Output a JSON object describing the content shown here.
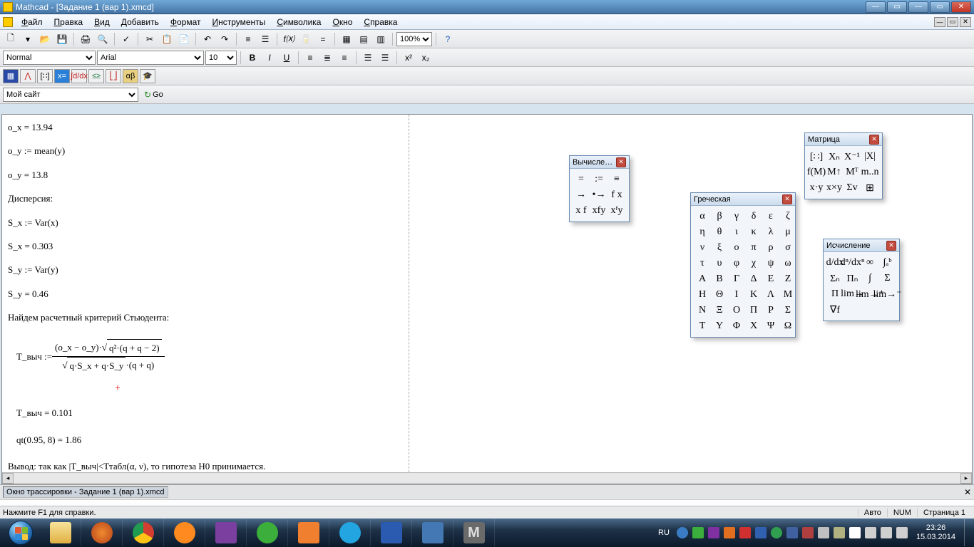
{
  "title": "Mathcad - [Задание 1 (вар 1).xmcd]",
  "menu": [
    "Файл",
    "Правка",
    "Вид",
    "Добавить",
    "Формат",
    "Инструменты",
    "Символика",
    "Окно",
    "Справка"
  ],
  "format_toolbar": {
    "style": "Normal",
    "font": "Arial",
    "size": "10"
  },
  "zoom": "100%",
  "addrbar": {
    "site": "Мой сайт",
    "go": "Go"
  },
  "doc": {
    "l1": "o_x = 13.94",
    "l2": "o_y := mean(y)",
    "l3": "o_y = 13.8",
    "l4": "Дисперсия:",
    "l5": "S_x := Var(x)",
    "l6": "S_x = 0.303",
    "l7": "S_y := Var(y)",
    "l8": "S_y = 0.46",
    "l9": "Найдем расчетный критерий Стьюдента:",
    "f_lhs": "T_выч := ",
    "f_num_a": "(o_x − o_y)·",
    "f_num_b": "q²·(q + q − 2)",
    "f_den_a": "q·S_x + q·S_y",
    "f_den_b": "·(q + q)",
    "l10": "T_выч = 0.101",
    "l11": "qt(0.95, 8) = 1.86",
    "l12": "Вывод: так как |T_выч|<Tтабл(α, ν), то гипотеза H0 принимается."
  },
  "palettes": {
    "vychisl": {
      "title": "Вычисле…",
      "cells": [
        "=",
        ":=",
        "≡",
        "→",
        "•→",
        "f x",
        "x f",
        "xfy",
        "xᶠy"
      ]
    },
    "greek": {
      "title": "Греческая",
      "cells": [
        "α",
        "β",
        "γ",
        "δ",
        "ε",
        "ζ",
        "η",
        "θ",
        "ι",
        "κ",
        "λ",
        "μ",
        "ν",
        "ξ",
        "ο",
        "π",
        "ρ",
        "σ",
        "τ",
        "υ",
        "φ",
        "χ",
        "ψ",
        "ω",
        "Α",
        "Β",
        "Γ",
        "Δ",
        "Ε",
        "Ζ",
        "Η",
        "Θ",
        "Ι",
        "Κ",
        "Λ",
        "Μ",
        "Ν",
        "Ξ",
        "Ο",
        "Π",
        "Ρ",
        "Σ",
        "Τ",
        "Υ",
        "Φ",
        "Χ",
        "Ψ",
        "Ω"
      ]
    },
    "matrix": {
      "title": "Матрица",
      "cells": [
        "[∷]",
        "Xₙ",
        "X⁻¹",
        "|X|",
        "f(M)",
        "M↑",
        "Mᵀ",
        "m..n",
        "x·y",
        "x×y",
        "Σv",
        "⊞"
      ]
    },
    "calc": {
      "title": "Исчисление",
      "cells": [
        "d/dx",
        "dⁿ/dxⁿ",
        "∞",
        "∫ₐᵇ",
        "Σₙ",
        "Πₙ",
        "∫",
        "Σ",
        "Π",
        "lim→",
        "lim→⁺",
        "lim→⁻",
        "∇f",
        "",
        "",
        ""
      ]
    }
  },
  "trace_title": "Окно трассировки - Задание 1 (вар 1).xmcd",
  "status": {
    "hint": "Нажмите F1 для справки.",
    "auto": "Авто",
    "num": "NUM",
    "page": "Страница 1"
  },
  "taskbar": {
    "lang": "RU",
    "time": "23:26",
    "date": "15.03.2014"
  }
}
